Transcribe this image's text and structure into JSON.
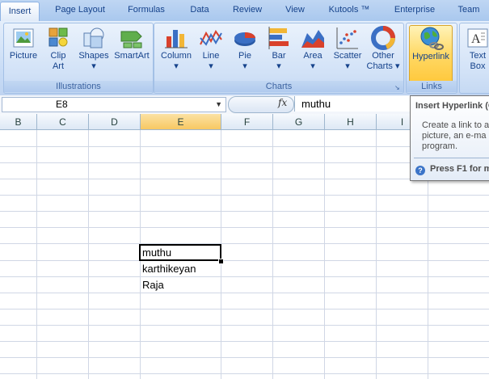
{
  "tabs": [
    "Insert",
    "Page Layout",
    "Formulas",
    "Data",
    "Review",
    "View",
    "Kutools ™",
    "Enterprise",
    "Team"
  ],
  "active_tab": "Insert",
  "ribbon": {
    "illustrations": {
      "label": "Illustrations",
      "buttons": [
        {
          "l1": "Picture",
          "l2": ""
        },
        {
          "l1": "Clip",
          "l2": "Art"
        },
        {
          "l1": "Shapes",
          "l2": "▾"
        },
        {
          "l1": "SmartArt",
          "l2": ""
        }
      ]
    },
    "charts": {
      "label": "Charts",
      "buttons": [
        {
          "l1": "Column",
          "l2": "▾"
        },
        {
          "l1": "Line",
          "l2": "▾"
        },
        {
          "l1": "Pie",
          "l2": "▾"
        },
        {
          "l1": "Bar",
          "l2": "▾"
        },
        {
          "l1": "Area",
          "l2": "▾"
        },
        {
          "l1": "Scatter",
          "l2": "▾"
        },
        {
          "l1": "Other",
          "l2": "Charts ▾"
        }
      ]
    },
    "links": {
      "label": "Links",
      "buttons": [
        {
          "l1": "Hyperlink",
          "l2": ""
        }
      ]
    },
    "text": {
      "buttons": [
        {
          "l1": "Text",
          "l2": "Box"
        }
      ]
    }
  },
  "formula_bar": {
    "name_box": "E8",
    "fx": "fx",
    "value": "muthu"
  },
  "columns": [
    "B",
    "C",
    "D",
    "E",
    "F",
    "G",
    "H",
    "I"
  ],
  "selected_column": "E",
  "cells": {
    "e8": "muthu",
    "e9": "karthikeyan",
    "e10": "Raja"
  },
  "tooltip": {
    "title": "Insert Hyperlink (C",
    "line1": "Create a link to a",
    "line2": "picture, an e-ma",
    "line3": "program.",
    "help": "Press F1 for m"
  },
  "colors": {
    "ribbon_bg": "#c7dbf5",
    "highlight": "#ffd966",
    "selected_header": "#f8c862"
  }
}
